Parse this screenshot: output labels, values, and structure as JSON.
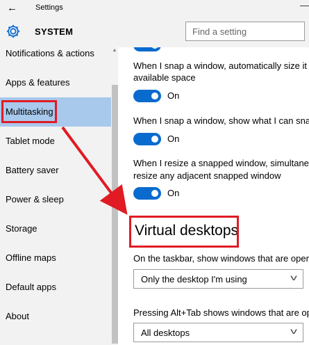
{
  "window": {
    "title": "Settings",
    "back_icon": "back-arrow-icon"
  },
  "header": {
    "section": "SYSTEM",
    "search_placeholder": "Find a setting"
  },
  "sidebar": {
    "items": [
      {
        "label": "Notifications & actions"
      },
      {
        "label": "Apps & features"
      },
      {
        "label": "Multitasking",
        "selected": true
      },
      {
        "label": "Tablet mode"
      },
      {
        "label": "Battery saver"
      },
      {
        "label": "Power & sleep"
      },
      {
        "label": "Storage"
      },
      {
        "label": "Offline maps"
      },
      {
        "label": "Default apps"
      },
      {
        "label": "About"
      }
    ]
  },
  "content": {
    "snap1": {
      "text_line1": "When I snap a window, automatically size it",
      "text_line2": "available space",
      "toggle_label": "On"
    },
    "snap2": {
      "text": "When I snap a window, show what I can snap",
      "toggle_label": "On"
    },
    "snap3": {
      "text_line1": "When I resize a snapped window, simultaneously",
      "text_line2": "resize any adjacent snapped window",
      "toggle_label": "On"
    },
    "virtual_desktops": {
      "title": "Virtual desktops",
      "taskbar_label": "On the taskbar, show windows that are open on",
      "taskbar_value": "Only the desktop I'm using",
      "alttab_label": "Pressing Alt+Tab shows windows that are open on",
      "alttab_value": "All desktops"
    }
  },
  "colors": {
    "accent": "#0a6bce",
    "selected": "#a8c8ec",
    "highlight": "#e01b24"
  }
}
